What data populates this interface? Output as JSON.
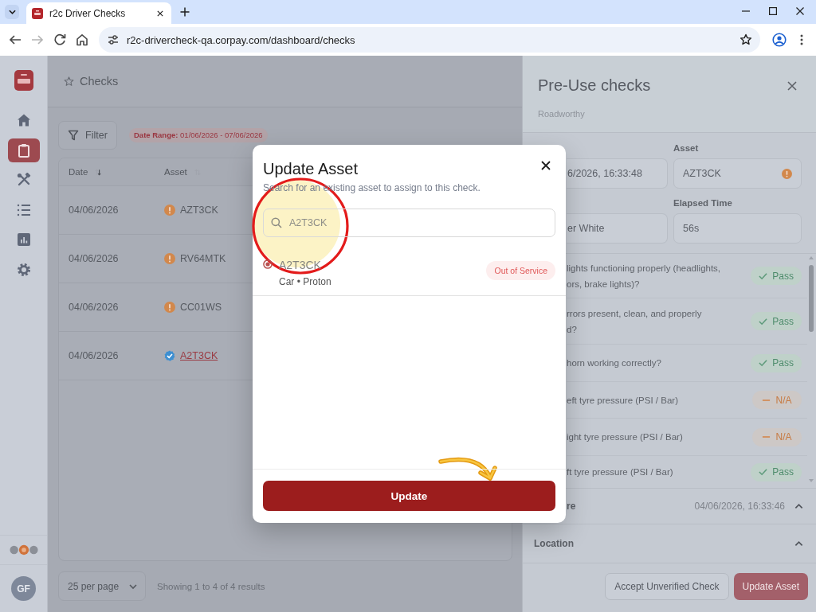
{
  "browser": {
    "tab_title": "r2c Driver Checks",
    "url": "r2c-drivercheck-qa.corpay.com/dashboard/checks",
    "back_disabled": false,
    "forward_disabled": true
  },
  "sidebar": {
    "nav": [
      {
        "selected": false
      },
      {
        "selected": true
      },
      {
        "selected": false
      },
      {
        "selected": false
      },
      {
        "selected": false
      },
      {
        "selected": false
      }
    ],
    "avatar_initials": "GF"
  },
  "page": {
    "title": "Checks",
    "filter_button": "Filter",
    "date_range": "**Date Range:** 01/06/2026 - 07/06/2026"
  },
  "table": {
    "columns": [
      {
        "label": "Date",
        "sorted": true
      },
      {
        "label": "Asset",
        "sorted": false
      }
    ],
    "rows": [
      {
        "date": "04/06/2026",
        "asset": "AZT3CK",
        "verified": false
      },
      {
        "date": "04/06/2026",
        "asset": "RV64MTK",
        "verified": false
      },
      {
        "date": "04/06/2026",
        "asset": "CC01WS",
        "verified": false
      },
      {
        "date": "04/06/2026",
        "asset": "A2T3CK",
        "verified": true
      }
    ]
  },
  "pagination": {
    "per_page": "25 per page",
    "summary": "Showing 1 to 4 of 4 results"
  },
  "panel": {
    "title": "Pre-Use checks",
    "subtitle": "Roadworthy",
    "fields": [
      {
        "value": "6/2026, 16:33:48",
        "warning": false
      },
      {
        "label": "Asset",
        "value": "AZT3CK",
        "warning": true
      },
      {
        "value": "er White",
        "warning": false
      },
      {
        "label": "Elapsed Time",
        "value": "56s",
        "warning": false
      }
    ],
    "checklist": [
      {
        "question": "lights functioning properly (headlights,\nors, brake lights)?",
        "kind": "pass",
        "badge": "Pass"
      },
      {
        "question": "rrors present, clean, and properly\nd?",
        "kind": "pass",
        "badge": "Pass"
      },
      {
        "question": "horn working correctly?",
        "kind": "pass",
        "badge": "Pass"
      },
      {
        "question": "eft tyre pressure (PSI / Bar)",
        "kind": "na",
        "badge": "N/A"
      },
      {
        "question": "ight tyre pressure (PSI / Bar)",
        "kind": "na",
        "badge": "N/A"
      },
      {
        "question": "ft tyre pressure (PSI / Bar)",
        "kind": "pass",
        "badge": "Pass"
      }
    ],
    "sections": [
      {
        "label": "re",
        "value": "04/06/2026, 16:33:46",
        "expanded": true
      },
      {
        "label": "Location",
        "expanded": true
      }
    ],
    "actions": [
      {
        "label": "Accept Unverified Check",
        "kind": "secondary"
      },
      {
        "label": "Update Asset",
        "kind": "primary"
      }
    ]
  },
  "modal": {
    "title": "Update Asset",
    "subtitle": "Search for an existing asset to assign to this check.",
    "search": {
      "value": "A2T3CK"
    },
    "results": [
      {
        "name": "A2T3CK",
        "details": "Car • Proton",
        "status": "Out of Service",
        "selected": true
      }
    ],
    "button": "Update"
  }
}
